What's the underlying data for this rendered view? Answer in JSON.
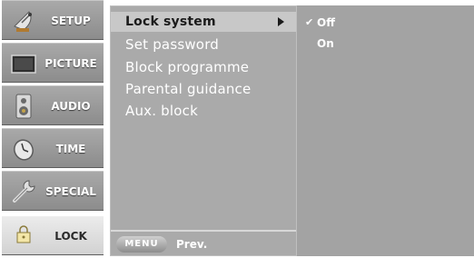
{
  "sidebar": {
    "items": [
      {
        "label": "SETUP",
        "icon": "satellite-dish-icon"
      },
      {
        "label": "PICTURE",
        "icon": "tv-screen-icon"
      },
      {
        "label": "AUDIO",
        "icon": "speaker-icon"
      },
      {
        "label": "TIME",
        "icon": "clock-icon"
      },
      {
        "label": "SPECIAL",
        "icon": "tools-icon"
      },
      {
        "label": "LOCK",
        "icon": "lock-icon"
      }
    ],
    "active_index": 5
  },
  "submenu": {
    "items": [
      {
        "label": "Lock system"
      },
      {
        "label": "Set password"
      },
      {
        "label": "Block programme"
      },
      {
        "label": "Parental guidance"
      },
      {
        "label": "Aux. block"
      }
    ],
    "selected_index": 0,
    "footer": {
      "menu_label": "MENU",
      "prev_label": "Prev."
    }
  },
  "options": {
    "items": [
      {
        "label": "Off",
        "checked": true
      },
      {
        "label": "On",
        "checked": false
      }
    ],
    "check_glyph": "✔"
  },
  "colors": {
    "sidebar_inactive": "#8c8c8c",
    "sidebar_active": "#dcdcdc",
    "submenu_bg": "#aaaaaa",
    "highlight": "#c8c8c8",
    "options_bg": "#a3a3a3"
  }
}
